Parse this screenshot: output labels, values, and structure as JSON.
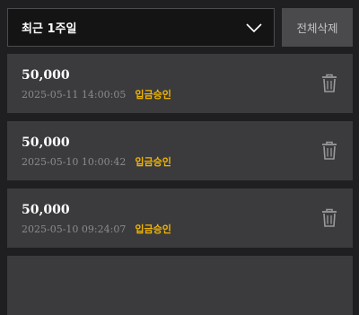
{
  "filter": {
    "selected": "최근 1주일",
    "icon": "chevron-down-icon"
  },
  "toolbar": {
    "delete_all_label": "전체삭제"
  },
  "history": [
    {
      "amount": "50,000",
      "datetime": "2025-05-11 14:00:05",
      "status": "입금승인"
    },
    {
      "amount": "50,000",
      "datetime": "2025-05-10 10:00:42",
      "status": "입금승인"
    },
    {
      "amount": "50,000",
      "datetime": "2025-05-10 09:24:07",
      "status": "입금승인"
    },
    {
      "amount": "",
      "datetime": "",
      "status": ""
    }
  ],
  "colors": {
    "background": "#1f1f21",
    "card": "#3b3b3e",
    "status": "#f0b400",
    "button": "#4a4a4d"
  }
}
